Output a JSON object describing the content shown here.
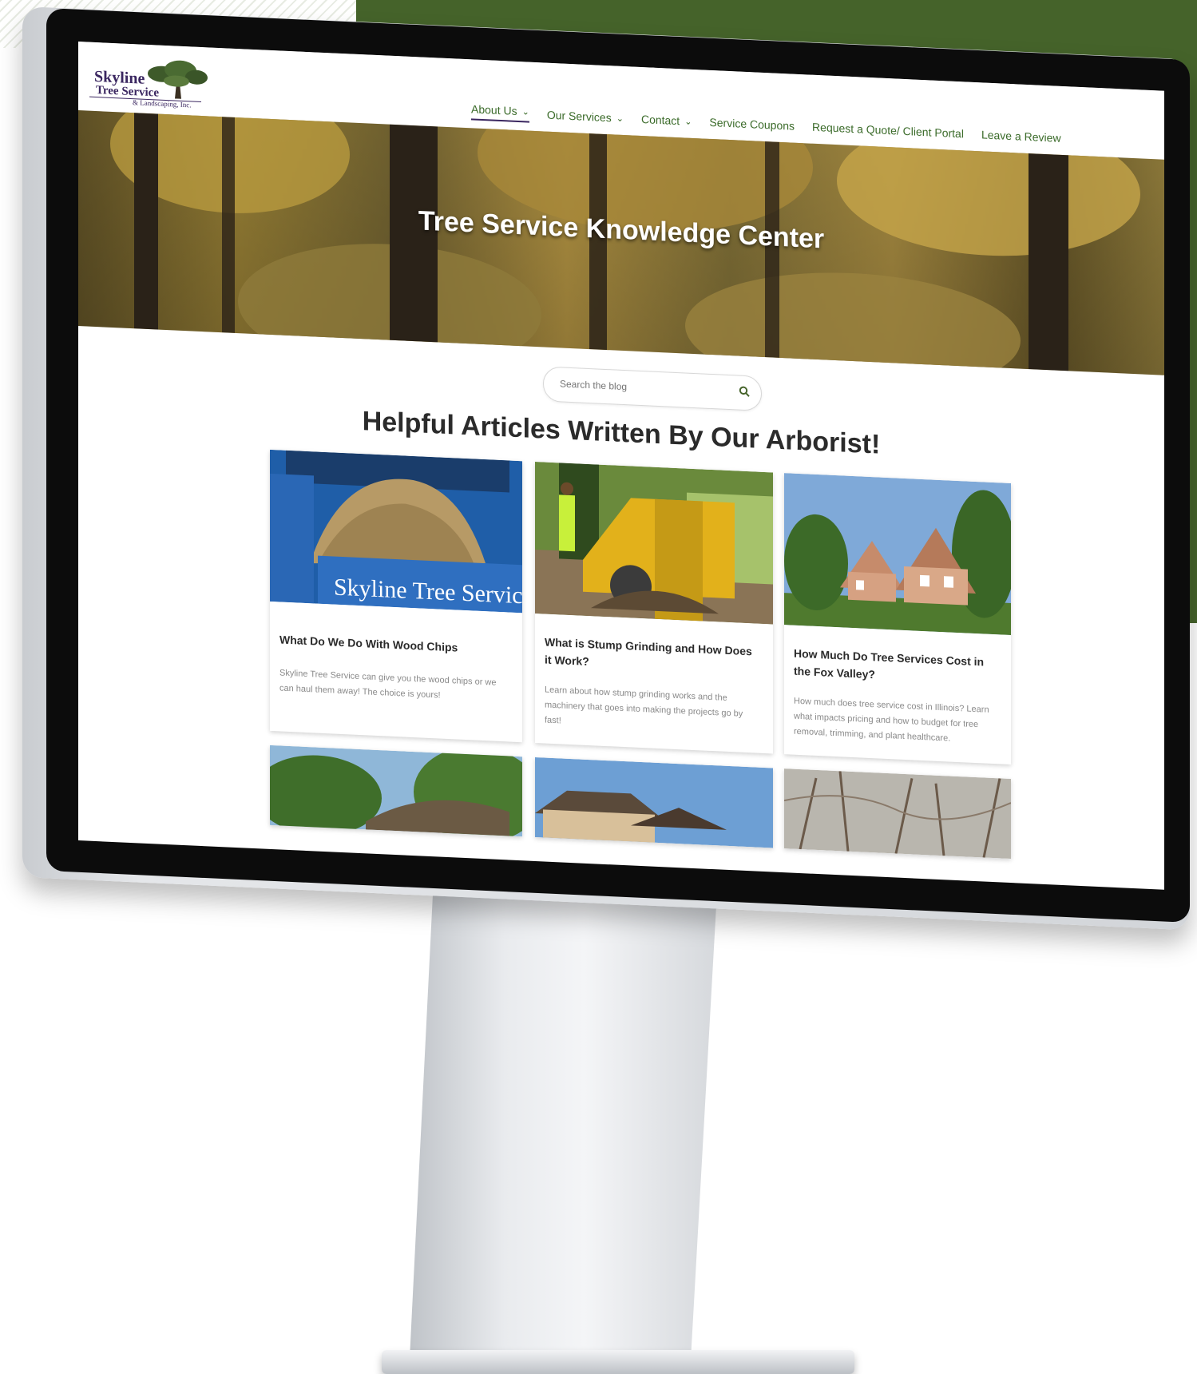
{
  "logo": {
    "line1": "Skyline",
    "line2": "Tree Service",
    "line3": "& Landscaping, Inc."
  },
  "nav": {
    "items": [
      {
        "label": "About Us",
        "has_dropdown": true,
        "active": true
      },
      {
        "label": "Our Services",
        "has_dropdown": true
      },
      {
        "label": "Contact",
        "has_dropdown": true
      },
      {
        "label": "Service Coupons"
      },
      {
        "label": "Request a Quote/ Client Portal"
      },
      {
        "label": "Leave a Review"
      }
    ],
    "chevron": "⌄"
  },
  "hero": {
    "title": "Tree Service Knowledge Center"
  },
  "search": {
    "placeholder": "Search the blog",
    "icon": "search-icon"
  },
  "section": {
    "title": "Helpful Articles Written By Our Arborist!"
  },
  "cards": [
    {
      "title": "What Do We Do With Wood Chips",
      "desc": "Skyline Tree Service can give you the wood chips or we can haul them away! The choice is yours!",
      "image_text": "Skyline Tree Service"
    },
    {
      "title": "What is Stump Grinding and How Does it Work?",
      "desc": "Learn about how stump grinding works and the machinery that goes into making the projects go by fast!"
    },
    {
      "title": "How Much Do Tree Services Cost in the Fox Valley?",
      "desc": "How much does tree service cost in Illinois? Learn what impacts pricing and how to budget for tree removal, trimming, and plant healthcare."
    }
  ],
  "colors": {
    "brand_green": "#45632a",
    "nav_green": "#3b6b2a",
    "logo_purple": "#3a2660"
  }
}
